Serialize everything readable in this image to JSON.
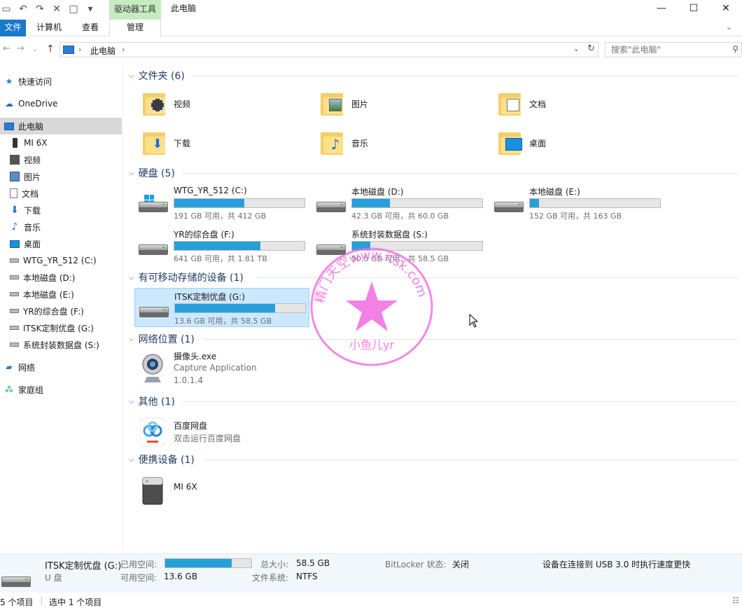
{
  "titlebar": {
    "tool_tab": "驱动器工具",
    "title": "此电脑"
  },
  "ribbon": {
    "file": "文件",
    "computer": "计算机",
    "view": "查看",
    "manage": "管理"
  },
  "address": {
    "path": "此电脑",
    "search_placeholder": "搜索\"此电脑\""
  },
  "sidebar": {
    "items": [
      {
        "label": "快速访问"
      },
      {
        "label": "OneDrive"
      },
      {
        "label": "此电脑"
      },
      {
        "label": "MI 6X"
      },
      {
        "label": "视频"
      },
      {
        "label": "图片"
      },
      {
        "label": "文档"
      },
      {
        "label": "下载"
      },
      {
        "label": "音乐"
      },
      {
        "label": "桌面"
      },
      {
        "label": "WTG_YR_512 (C:)"
      },
      {
        "label": "本地磁盘 (D:)"
      },
      {
        "label": "本地磁盘 (E:)"
      },
      {
        "label": "YR的综合盘 (F:)"
      },
      {
        "label": "ITSK定制优盘 (G:)"
      },
      {
        "label": "系统封装数据盘 (S:)"
      },
      {
        "label": "网络"
      },
      {
        "label": "家庭组"
      }
    ]
  },
  "sections": {
    "folders": "文件夹 (6)",
    "drives": "硬盘 (5)",
    "removable": "有可移动存储的设备 (1)",
    "network": "网络位置 (1)",
    "other": "其他 (1)",
    "portable": "便携设备 (1)"
  },
  "folders": [
    {
      "name": "视频"
    },
    {
      "name": "图片"
    },
    {
      "name": "文档"
    },
    {
      "name": "下载"
    },
    {
      "name": "音乐"
    },
    {
      "name": "桌面"
    }
  ],
  "drives": [
    {
      "name": "WTG_YR_512 (C:)",
      "info": "191 GB 可用，共 412 GB",
      "used_fraction": 0.54
    },
    {
      "name": "本地磁盘 (D:)",
      "info": "42.3 GB 可用，共 60.0 GB",
      "used_fraction": 0.29
    },
    {
      "name": "本地磁盘 (E:)",
      "info": "152 GB 可用，共 163 GB",
      "used_fraction": 0.07
    },
    {
      "name": "YR的综合盘 (F:)",
      "info": "641 GB 可用，共 1.81 TB",
      "used_fraction": 0.66
    },
    {
      "name": "系统封装数据盘 (S:)",
      "info": "50.5 GB 可用，共 58.5 GB",
      "used_fraction": 0.14
    }
  ],
  "removable": [
    {
      "name": "ITSK定制优盘 (G:)",
      "info": "13.6 GB 可用，共 58.5 GB",
      "used_fraction": 0.77
    }
  ],
  "network": {
    "name": "摄像头.exe",
    "desc": "Capture Application",
    "version": "1.0.1.4"
  },
  "other": {
    "name": "百度网盘",
    "desc": "双击运行百度网盘"
  },
  "portable": {
    "name": "MI 6X"
  },
  "details": {
    "name": "ITSK定制优盘 (G:)",
    "type": "U 盘",
    "used_label": "已用空间:",
    "used_fraction": 0.77,
    "free_label": "可用空间:",
    "free_value": "13.6 GB",
    "total_label": "总大小:",
    "total_value": "58.5 GB",
    "fs_label": "文件系统:",
    "fs_value": "NTFS",
    "bitlocker_label": "BitLocker 状态:",
    "bitlocker_value": "关闭",
    "tip": "设备在连接到 USB 3.0 时执行速度更快"
  },
  "status": {
    "count": "5 个项目",
    "selected": "选中 1 个项目"
  },
  "watermark": {
    "ring_text": "精门天空www.itsk.com",
    "bottom_text": "小鱼儿yr"
  },
  "colors": {
    "accent": "#1979ca",
    "bar_fill": "#26a0da",
    "selection": "#cce8ff",
    "watermark": "#f06ae0"
  }
}
